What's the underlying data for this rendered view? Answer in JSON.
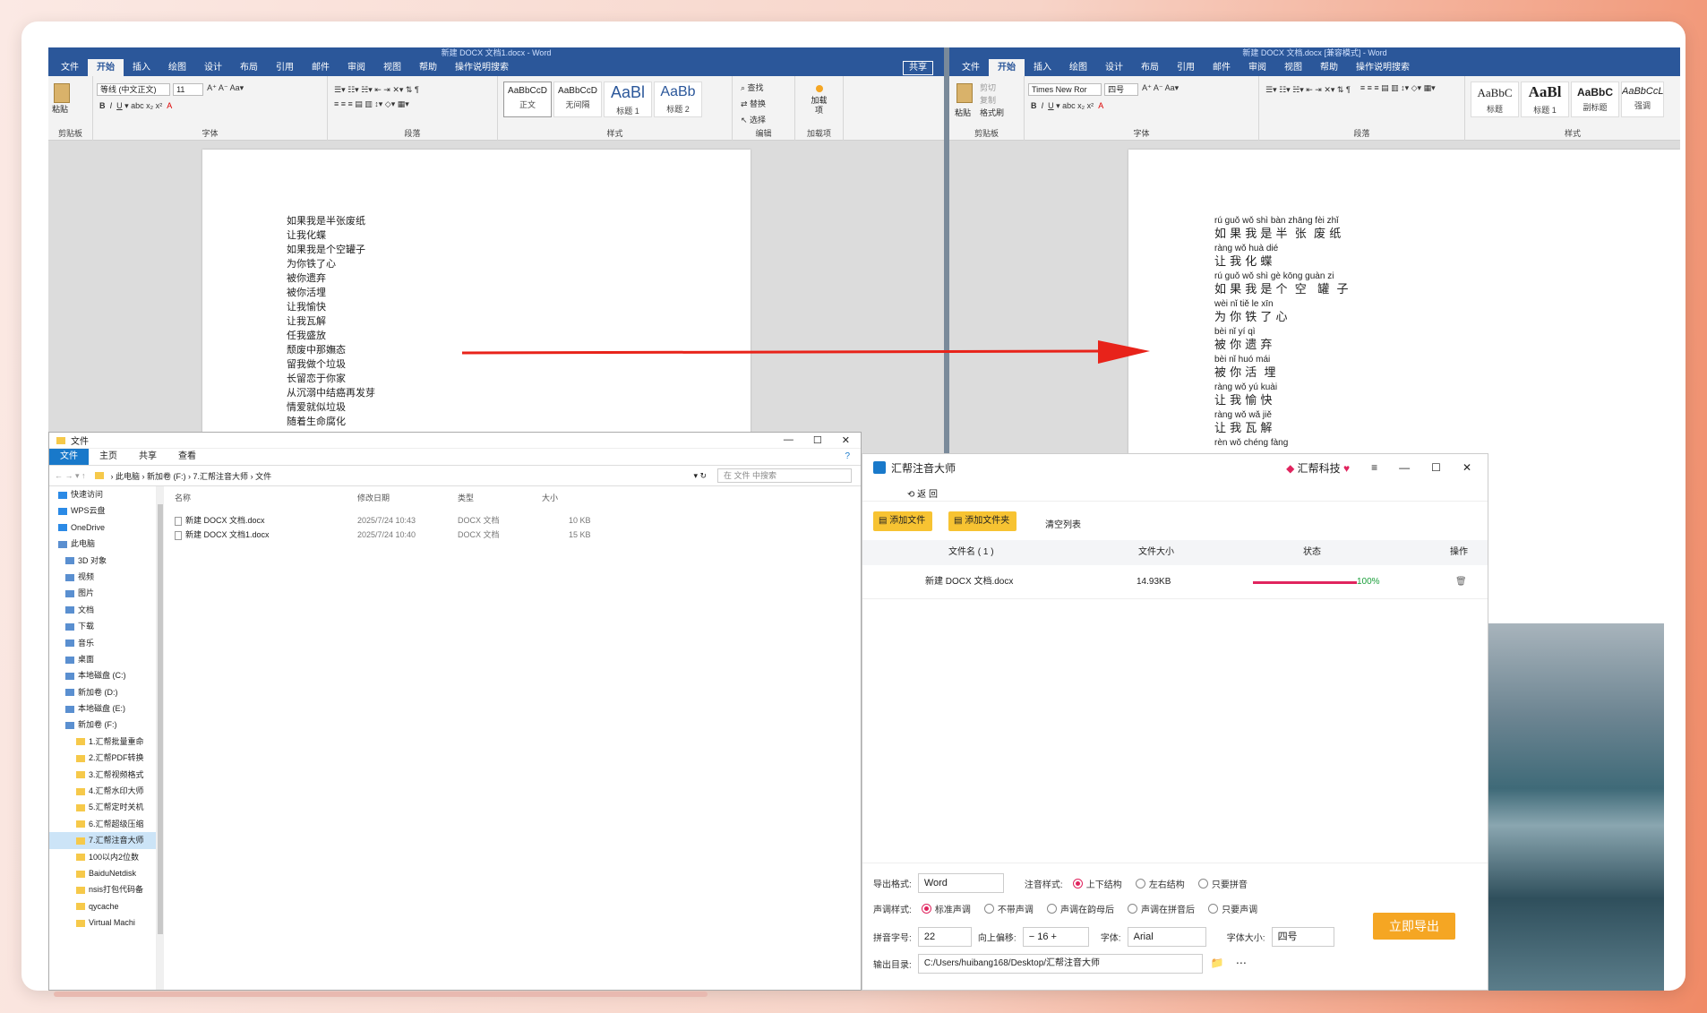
{
  "word_left": {
    "title": "新建 DOCX 文档1.docx - Word",
    "tabs": [
      "文件",
      "开始",
      "插入",
      "绘图",
      "设计",
      "布局",
      "引用",
      "邮件",
      "审阅",
      "视图",
      "帮助",
      "操作说明搜索"
    ],
    "share": "共享",
    "font": "等线 (中文正文)",
    "size": "11",
    "groups": [
      "剪贴板",
      "字体",
      "段落",
      "样式",
      "编辑",
      "加载项"
    ],
    "styles": [
      {
        "p": "AaBbCcD",
        "n": "正文"
      },
      {
        "p": "AaBbCcD",
        "n": "无间隔"
      },
      {
        "p": "AaBl",
        "n": "标题 1"
      },
      {
        "p": "AaBb",
        "n": "标题 2"
      }
    ],
    "edit": [
      "查找",
      "替换",
      "选择"
    ],
    "addin": "加载项",
    "paste": "粘贴",
    "lines": [
      "如果我是半张废纸",
      "让我化蝶",
      "如果我是个空罐子",
      "为你铁了心",
      "被你遗弃",
      "被你活埋",
      "让我愉快",
      "让我瓦解",
      "任我盛放",
      "颓废中那嫵态",
      "留我做个垃圾",
      "长留恋于你家",
      "从沉溺中结癌再发芽",
      "情爱就似垃圾",
      "随着生命腐化"
    ]
  },
  "word_right": {
    "title": "新建 DOCX 文档.docx [兼容模式] - Word",
    "tabs": [
      "文件",
      "开始",
      "插入",
      "绘图",
      "设计",
      "布局",
      "引用",
      "邮件",
      "审阅",
      "视图",
      "帮助",
      "操作说明搜索"
    ],
    "font": "Times New Ror",
    "size": "四号",
    "groups": [
      "剪贴板",
      "字体",
      "段落",
      "样式"
    ],
    "styles": [
      {
        "p": "AaBbC",
        "n": "标题"
      },
      {
        "p": "AaBl",
        "n": "标题 1"
      },
      {
        "p": "AaBbC",
        "n": "副标题"
      },
      {
        "p": "AaBbCcL",
        "n": "强调"
      }
    ],
    "paste": "粘贴",
    "cut": "剪切",
    "copy": "复制",
    "painter": "格式刷",
    "pairs": [
      {
        "py": "rú guǒ wǒ shì bàn zhāng fèi zhǐ",
        "hz": "如 果 我 是 半  张  废 纸"
      },
      {
        "py": "ràng wǒ huà dié",
        "hz": "让 我 化 蝶"
      },
      {
        "py": "rú guǒ wǒ shì gè kōng guàn zi",
        "hz": "如 果 我 是 个  空   罐  子"
      },
      {
        "py": "wèi nǐ tiě le xīn",
        "hz": "为 你 铁 了 心"
      },
      {
        "py": "bèi nǐ yí qì",
        "hz": "被 你 遗 弃"
      },
      {
        "py": "bèi nǐ huó mái",
        "hz": "被 你 活  埋"
      },
      {
        "py": "ràng wǒ yú kuài",
        "hz": "让 我 愉 快"
      },
      {
        "py": "ràng wǒ wǎ jiě",
        "hz": "让 我 瓦 解"
      },
      {
        "py": "rèn wǒ chéng fàng",
        "hz": ""
      }
    ]
  },
  "explorer": {
    "title": "文件",
    "tabs": [
      "文件",
      "主页",
      "共享",
      "查看"
    ],
    "path": [
      "此电脑",
      "新加卷 (F:)",
      "7.汇帮注音大师",
      "文件"
    ],
    "search": "在 文件 中搜索",
    "cols": [
      "名称",
      "修改日期",
      "类型",
      "大小"
    ],
    "files": [
      {
        "name": "新建 DOCX 文档.docx",
        "date": "2025/7/24 10:43",
        "type": "DOCX 文档",
        "size": "10 KB"
      },
      {
        "name": "新建 DOCX 文档1.docx",
        "date": "2025/7/24 10:40",
        "type": "DOCX 文档",
        "size": "15 KB"
      }
    ],
    "tree": [
      "快速访问",
      "WPS云盘",
      "OneDrive",
      "此电脑",
      "3D 对象",
      "视频",
      "图片",
      "文档",
      "下载",
      "音乐",
      "桌面",
      "本地磁盘 (C:)",
      "新加卷 (D:)",
      "本地磁盘 (E:)",
      "新加卷 (F:)",
      "1.汇帮批量重命",
      "2.汇帮PDF转换",
      "3.汇帮视频格式",
      "4.汇帮水印大师",
      "5.汇帮定时关机",
      "6.汇帮超级压缩",
      "7.汇帮注音大师",
      "100以内2位数",
      "BaiduNetdisk",
      "nsis打包代码备",
      "qycache",
      "Virtual Machi"
    ]
  },
  "app": {
    "title": "汇帮注音大师",
    "brand": "汇帮科技",
    "back": "返 回",
    "add_file": "添加文件",
    "add_folder": "添加文件夹",
    "clear": "清空列表",
    "cols": [
      "文件名 ( 1 )",
      "文件大小",
      "状态",
      "操作"
    ],
    "row": {
      "name": "新建 DOCX 文档.docx",
      "size": "14.93KB",
      "pct": "100%",
      "progress": 1.0
    },
    "export_label": "导出格式:",
    "export_val": "Word",
    "note_label": "注音样式:",
    "note_opts": [
      "上下结构",
      "左右结构",
      "只要拼音"
    ],
    "tone_label": "声调样式:",
    "tone_opts": [
      "标准声调",
      "不带声调",
      "声调在韵母后",
      "声调在拼音后",
      "只要声调"
    ],
    "py_size_label": "拼音字号:",
    "py_size": "22",
    "offset_label": "向上偏移:",
    "offset": "16",
    "font_label": "字体:",
    "font": "Arial",
    "fsize_label": "字体大小:",
    "fsize": "四号",
    "out_label": "输出目录:",
    "out_path": "C:/Users/huibang168/Desktop/汇帮注音大师",
    "export_btn": "立即导出"
  },
  "colors": {
    "word": "#2b579a",
    "accent": "#e0245e",
    "yellow": "#f7c332",
    "orange": "#f5a623",
    "arrow": "#e8231a"
  }
}
